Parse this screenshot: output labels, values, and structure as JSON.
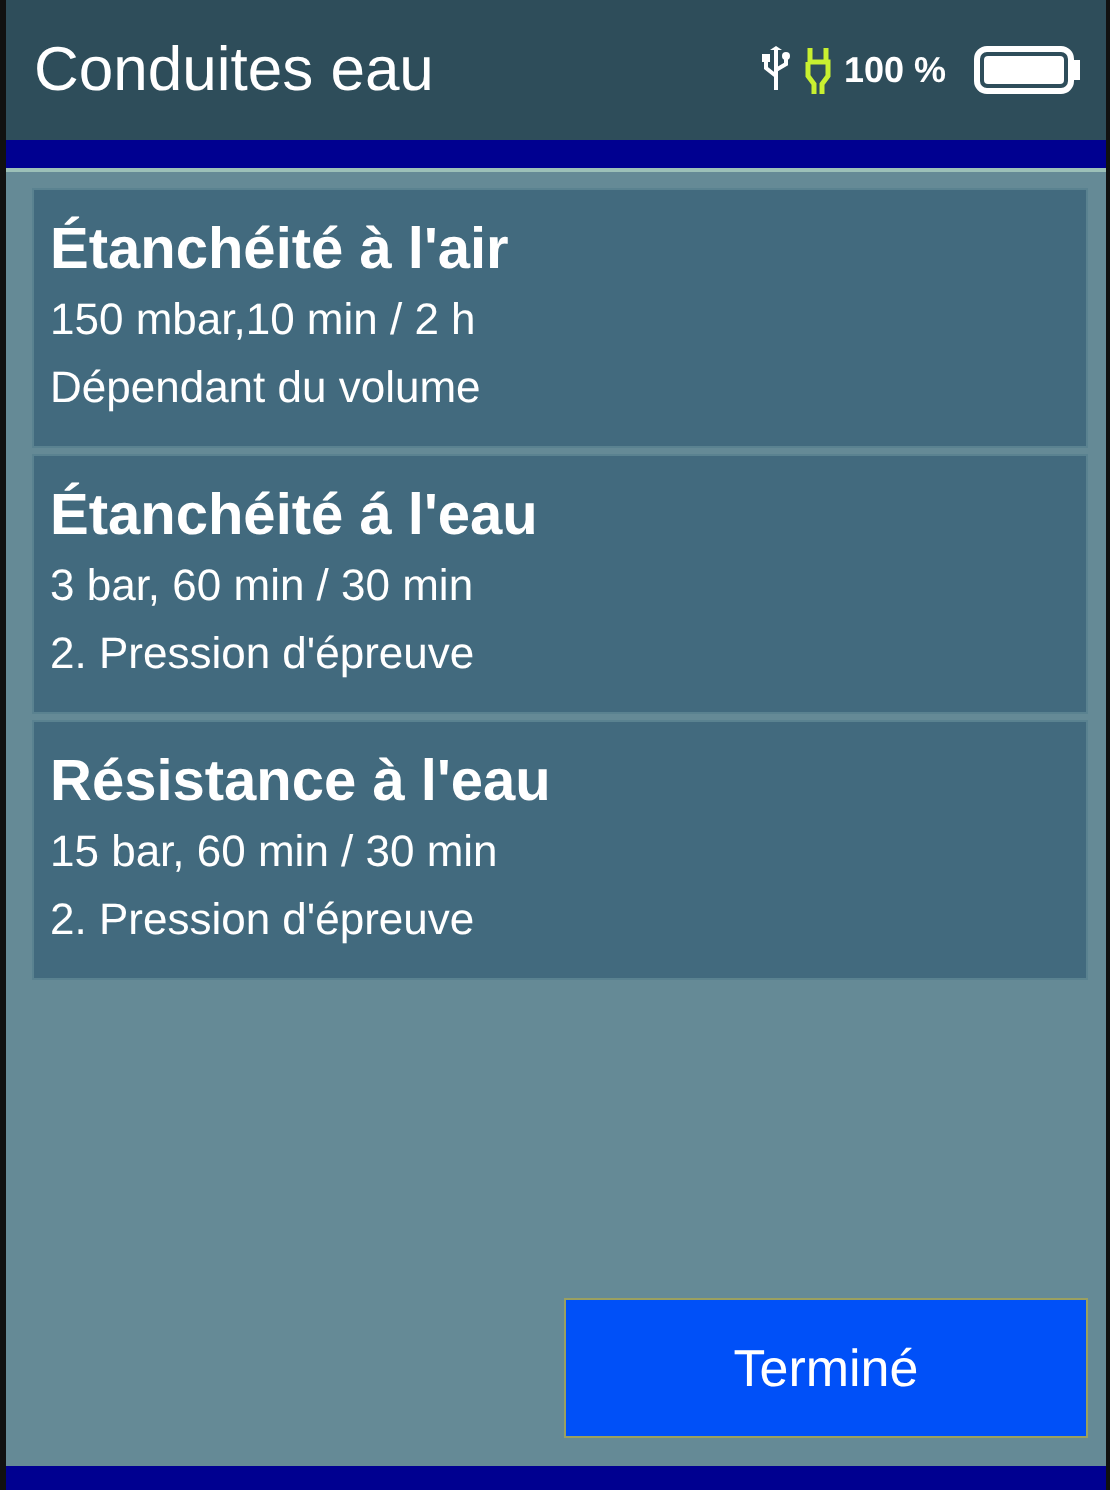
{
  "header": {
    "title": "Conduites eau",
    "battery_text": "100 %"
  },
  "tests": [
    {
      "title": "Étanchéité à l'air",
      "line_1": "150 mbar,10 min / 2 h",
      "line_2": "Dépendant du volume"
    },
    {
      "title": "Étanchéité á l'eau",
      "line_1": "3 bar, 60 min / 30 min",
      "line_2": "2. Pression d'épreuve"
    },
    {
      "title": "Résistance à l'eau",
      "line_1": "15 bar, 60 min / 30 min",
      "line_2": "2. Pression d'épreuve"
    }
  ],
  "done_button": "Terminé"
}
